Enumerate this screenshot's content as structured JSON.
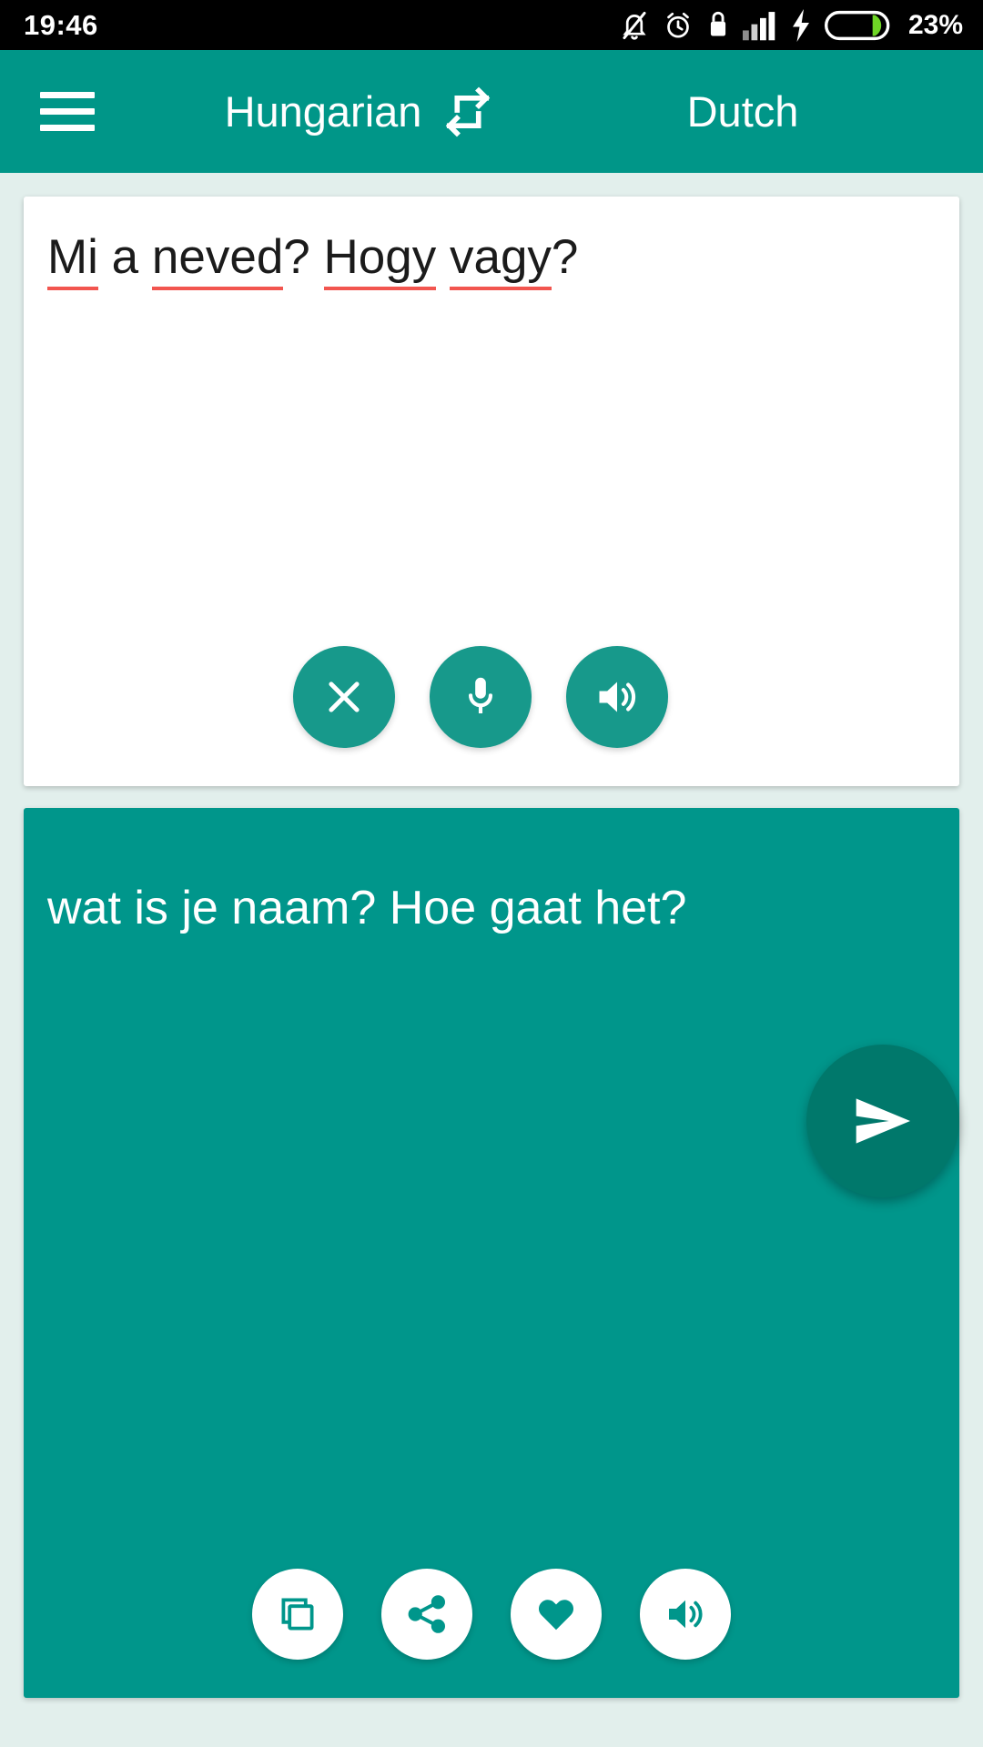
{
  "status_bar": {
    "time": "19:46",
    "battery_percent": "23%",
    "icons": [
      "bell-muted-icon",
      "alarm-clock-icon",
      "usb-lock-icon",
      "signal-bars-icon",
      "charging-bolt-icon",
      "battery-icon"
    ]
  },
  "app_bar": {
    "menu_icon": "hamburger-menu-icon",
    "source_language": "Hungarian",
    "swap_icon": "swap-languages-icon",
    "target_language": "Dutch"
  },
  "source_card": {
    "text": "Mi a neved? Hogy vagy?",
    "tokens": [
      {
        "t": "Mi",
        "misspelled": true
      },
      {
        "t": " ",
        "misspelled": false
      },
      {
        "t": "a",
        "misspelled": false
      },
      {
        "t": " ",
        "misspelled": false
      },
      {
        "t": "neved",
        "misspelled": true
      },
      {
        "t": "? ",
        "misspelled": false
      },
      {
        "t": "Hogy",
        "misspelled": true
      },
      {
        "t": " ",
        "misspelled": false
      },
      {
        "t": "vagy",
        "misspelled": true
      },
      {
        "t": "?",
        "misspelled": false
      }
    ],
    "actions": [
      {
        "name": "clear-button",
        "icon": "close-x-icon"
      },
      {
        "name": "microphone-button",
        "icon": "microphone-icon"
      },
      {
        "name": "speak-source-button",
        "icon": "speaker-icon"
      }
    ]
  },
  "send_button": {
    "name": "send-button",
    "icon": "send-paper-plane-icon"
  },
  "target_card": {
    "text": "wat is je naam? Hoe gaat het?",
    "actions": [
      {
        "name": "copy-button",
        "icon": "copy-icon"
      },
      {
        "name": "share-button",
        "icon": "share-icon"
      },
      {
        "name": "favorite-button",
        "icon": "heart-icon"
      },
      {
        "name": "speak-target-button",
        "icon": "speaker-icon"
      }
    ]
  },
  "colors": {
    "accent_teal": "#009688",
    "target_card_teal": "#00968b",
    "fab_teal": "#17998b",
    "send_fab_teal": "#00786b",
    "page_bg": "#e2efec",
    "spellcheck_red": "#f2554f",
    "battery_green": "#6fd626"
  }
}
